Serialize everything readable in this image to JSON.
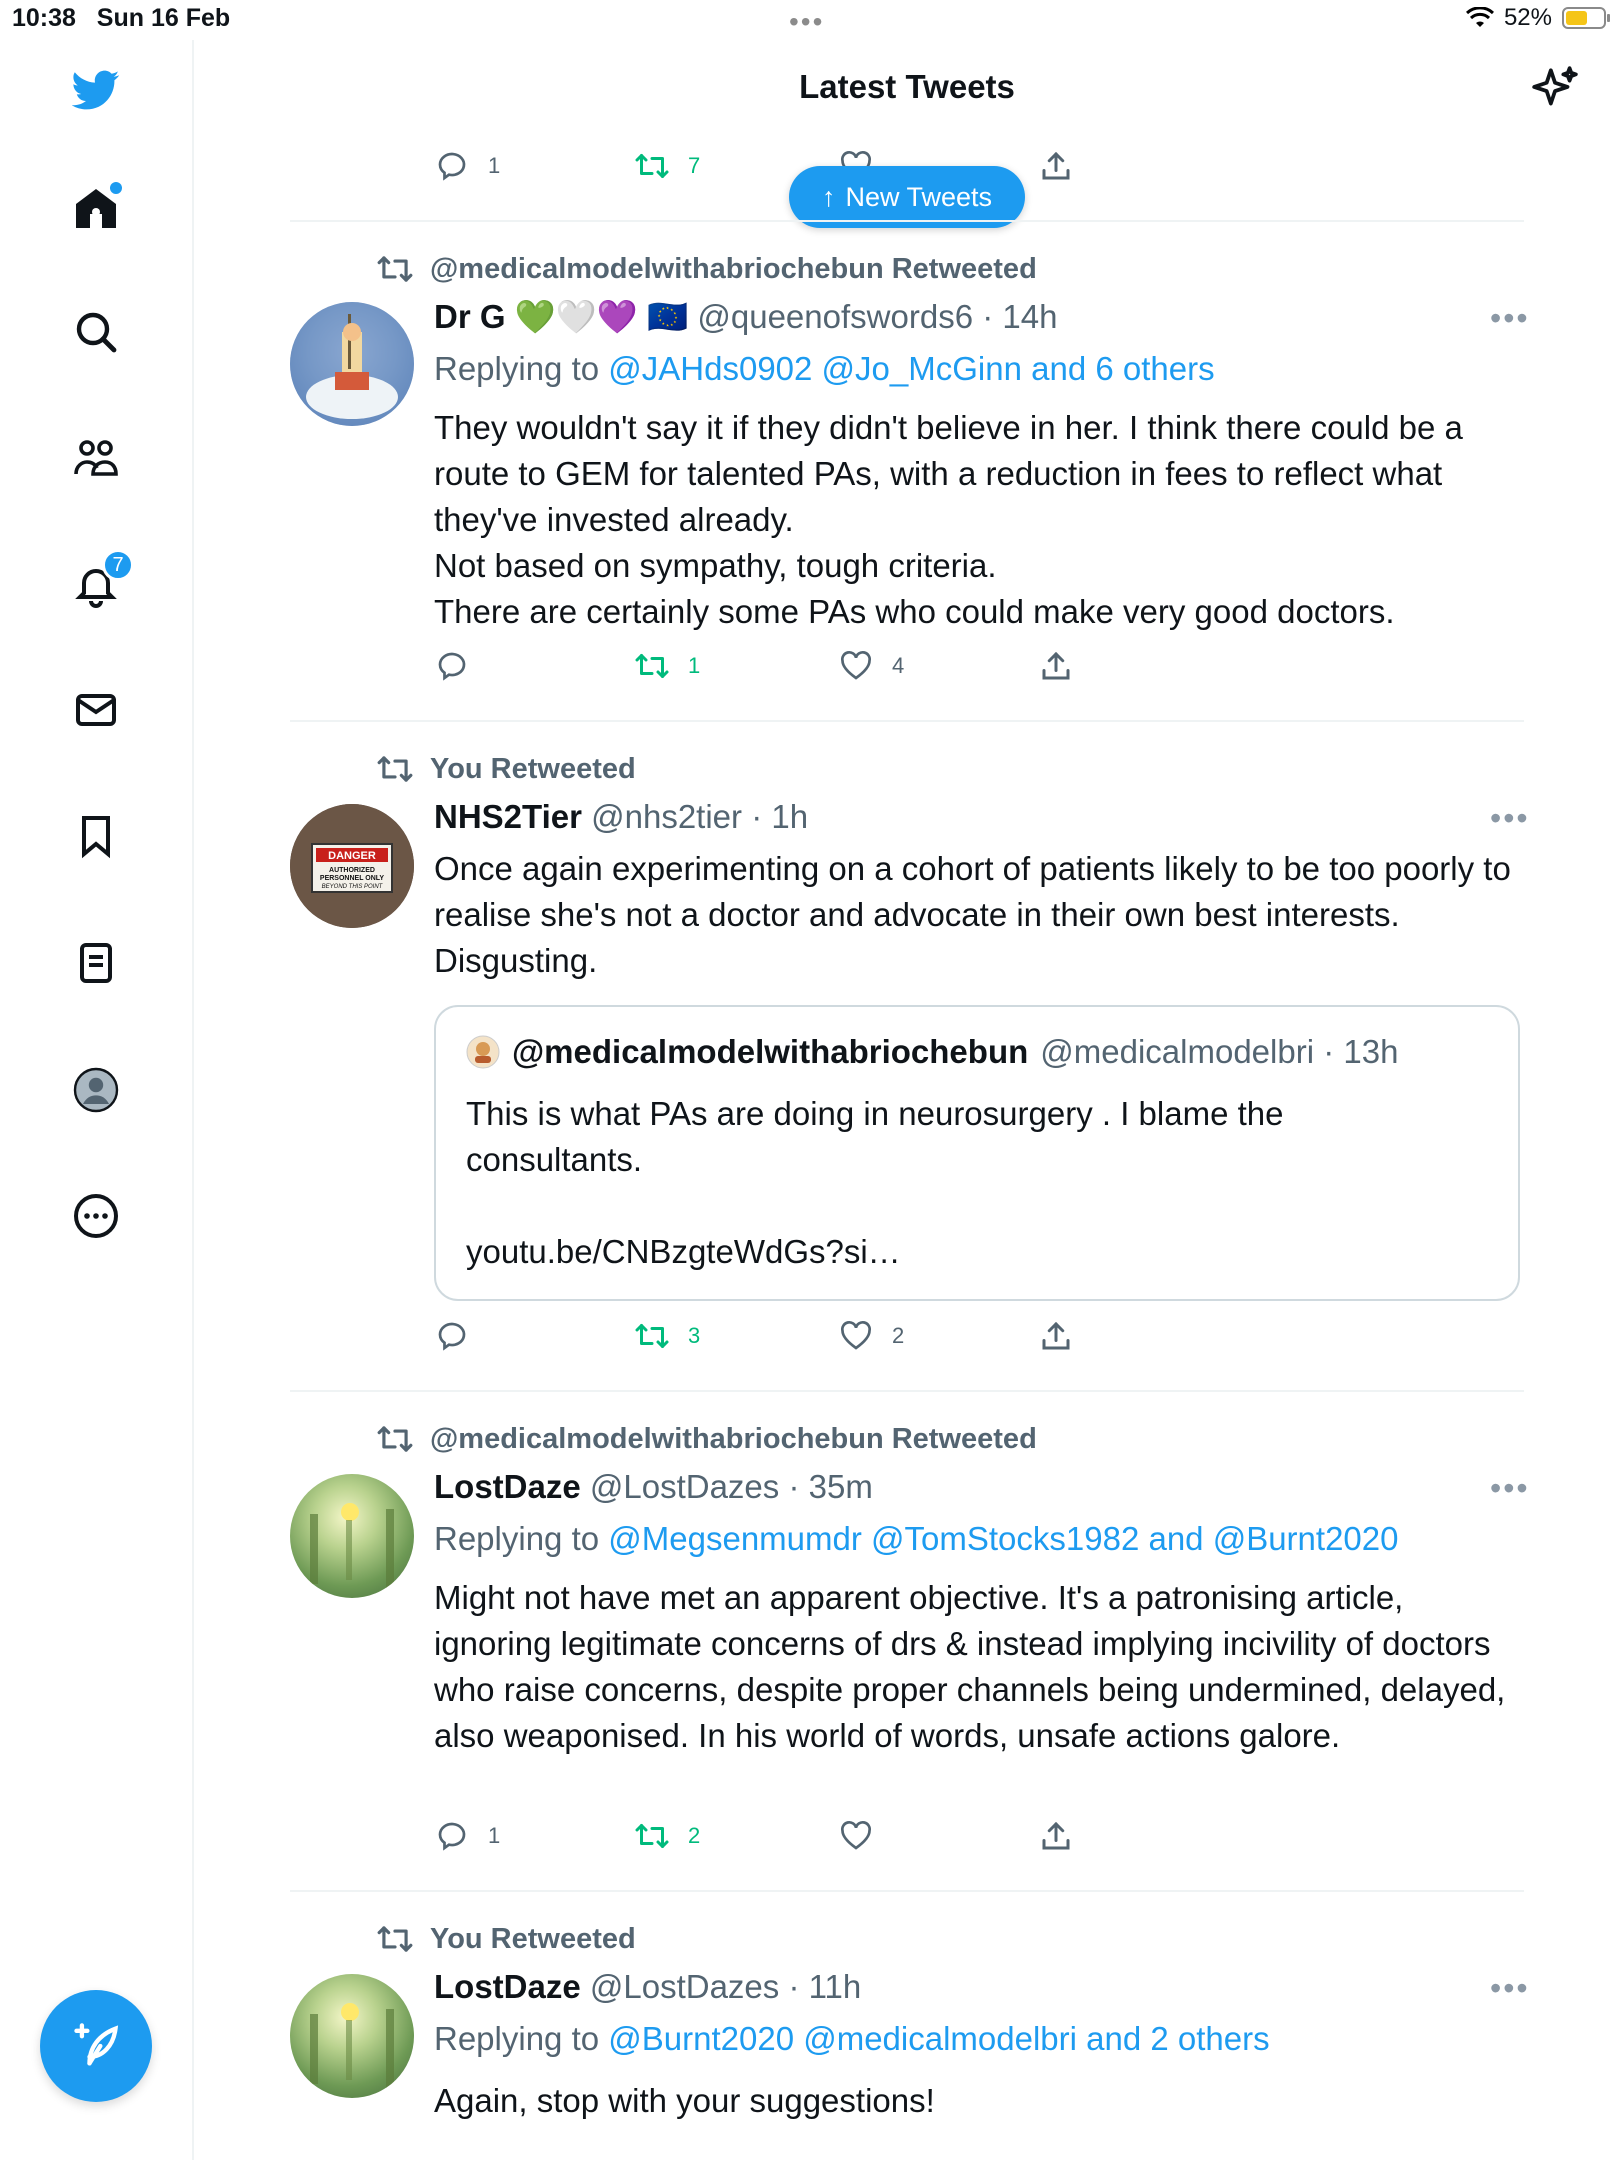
{
  "status_bar": {
    "time": "10:38",
    "date": "Sun 16 Feb",
    "battery": "52%",
    "battery_level": 0.52
  },
  "header": {
    "title": "Latest Tweets",
    "sparkle_icon": "sparkle-icon"
  },
  "sidebar": {
    "items": [
      {
        "name": "twitter-logo",
        "icon": "bird-icon"
      },
      {
        "name": "home",
        "icon": "home-icon"
      },
      {
        "name": "explore",
        "icon": "search-icon"
      },
      {
        "name": "communities",
        "icon": "people-icon"
      },
      {
        "name": "notifications",
        "icon": "bell-icon",
        "badge": "7"
      },
      {
        "name": "messages",
        "icon": "mail-icon"
      },
      {
        "name": "bookmarks",
        "icon": "bookmark-icon"
      },
      {
        "name": "lists",
        "icon": "list-icon"
      },
      {
        "name": "profile",
        "icon": "profile-icon"
      },
      {
        "name": "more",
        "icon": "more-circle-icon"
      }
    ],
    "compose_icon": "compose-icon"
  },
  "new_tweets_pill": {
    "label": "New Tweets"
  },
  "top_actions": {
    "replies": "1",
    "retweets": "7",
    "likes": ""
  },
  "tweets": [
    {
      "retweeted_by": "@medicalmodelwithabriochebun Retweeted",
      "name": "Dr G 💚🤍💜 🇪🇺",
      "handle": "@queenofswords6 · 14h",
      "replying_prefix": "Replying to ",
      "replying_to": "@JAHds0902 @Jo_McGinn and 6 others",
      "text": "They wouldn't say it if they didn't believe in her. I think there could be a route to GEM for talented PAs, with a reduction in fees to reflect what they've invested already.\nNot based on sympathy, tough criteria.\nThere are certainly some PAs who could make very good doctors.",
      "replies": "",
      "retweets": "1",
      "likes": "4"
    },
    {
      "retweeted_by": "You Retweeted",
      "name": "NHS2Tier",
      "handle": "@nhs2tier · 1h",
      "text": "Once again experimenting on a cohort of patients likely to be too poorly to realise she's not a doctor and advocate in their own best interests. Disgusting.",
      "avatar_sign": {
        "title": "DANGER",
        "line1": "AUTHORIZED",
        "line2": "PERSONNEL ONLY",
        "line3": "BEYOND THIS POINT"
      },
      "quote": {
        "name": "@medicalmodelwithabriochebun",
        "handle": "@medicalmodelbri · 13h",
        "text": "This is what PAs are doing in neurosurgery . I blame the consultants.\n\nyoutu.be/CNBzgteWdGs?si…"
      },
      "replies": "",
      "retweets": "3",
      "likes": "2"
    },
    {
      "retweeted_by": "@medicalmodelwithabriochebun Retweeted",
      "name": "LostDaze",
      "handle": "@LostDazes · 35m",
      "replying_prefix": "Replying to ",
      "replying_to": "@Megsenmumdr @TomStocks1982 and @Burnt2020",
      "text": "Might not have met an apparent objective. It's a patronising article, ignoring legitimate concerns of drs & instead implying incivility of doctors who raise concerns, despite proper channels being undermined, delayed, also weaponised. In his world of words, unsafe actions galore.",
      "replies": "1",
      "retweets": "2",
      "likes": ""
    },
    {
      "retweeted_by": "You Retweeted",
      "name": "LostDaze",
      "handle": "@LostDazes · 11h",
      "replying_prefix": "Replying to ",
      "replying_to": "@Burnt2020 @medicalmodelbri and 2 others",
      "text": "Again, stop with your suggestions!"
    }
  ],
  "colors": {
    "accent": "#1d9bf0",
    "retweet": "#00ba7c",
    "secondary_text": "#536471",
    "divider": "#eff3f4"
  }
}
